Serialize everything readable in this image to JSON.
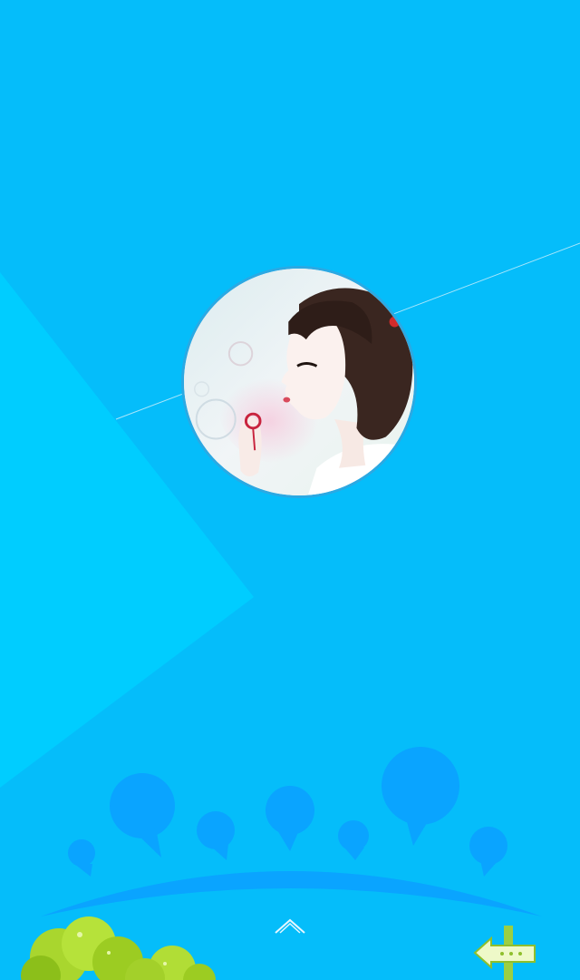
{
  "screen": {
    "background_color": "#05bdfa",
    "accent_bubble_color": "#0aa4ff",
    "panel_color": "#00cdff"
  },
  "avatar": {
    "icon": "girl-blowing-bubbles-portrait"
  },
  "controls": {
    "swipe_up": {
      "icon": "chevron-up-icon"
    },
    "back": {
      "icon": "back-arrow-signpost-icon"
    }
  },
  "decorations": {
    "bubbles": "speech-bubble-icons",
    "bushes": "green-bush-icon"
  }
}
